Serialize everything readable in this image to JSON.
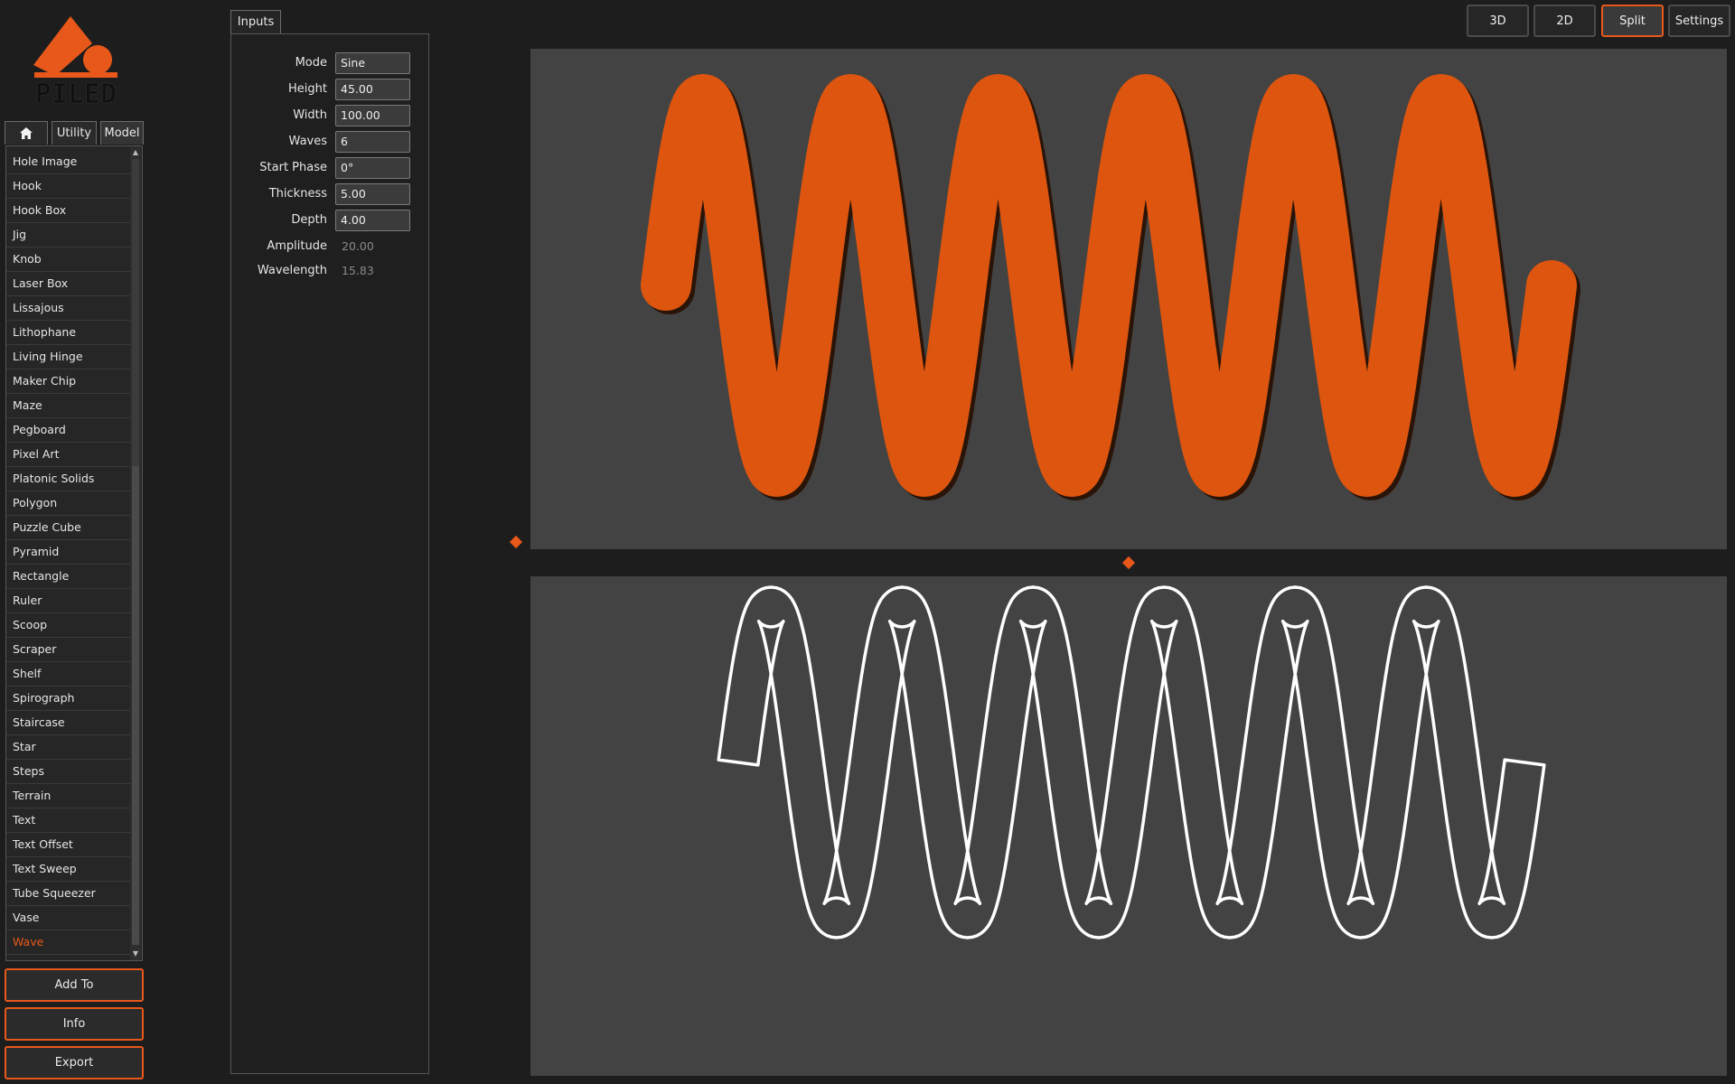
{
  "app": {
    "logo_text": "PILED",
    "accent": "#e8581a"
  },
  "sidebar": {
    "tabs": [
      {
        "icon": "home-icon"
      },
      {
        "label": "Utility"
      },
      {
        "label": "Model"
      }
    ],
    "items": [
      "Hole Image",
      "Hook",
      "Hook Box",
      "Jig",
      "Knob",
      "Laser Box",
      "Lissajous",
      "Lithophane",
      "Living Hinge",
      "Maker Chip",
      "Maze",
      "Pegboard",
      "Pixel Art",
      "Platonic Solids",
      "Polygon",
      "Puzzle Cube",
      "Pyramid",
      "Rectangle",
      "Ruler",
      "Scoop",
      "Scraper",
      "Shelf",
      "Spirograph",
      "Staircase",
      "Star",
      "Steps",
      "Terrain",
      "Text",
      "Text Offset",
      "Text Sweep",
      "Tube Squeezer",
      "Vase",
      "Wave"
    ],
    "active_item": "Wave",
    "actions": {
      "add_to": "Add To",
      "info": "Info",
      "export": "Export"
    }
  },
  "inputs": {
    "tab_label": "Inputs",
    "fields": [
      {
        "label": "Mode",
        "value": "Sine"
      },
      {
        "label": "Height",
        "value": "45.00"
      },
      {
        "label": "Width",
        "value": "100.00"
      },
      {
        "label": "Waves",
        "value": "6"
      },
      {
        "label": "Start Phase",
        "value": "0°"
      },
      {
        "label": "Thickness",
        "value": "5.00"
      },
      {
        "label": "Depth",
        "value": "4.00"
      }
    ],
    "readonly": [
      {
        "label": "Amplitude",
        "value": "20.00"
      },
      {
        "label": "Wavelength",
        "value": "15.83"
      }
    ]
  },
  "view_buttons": {
    "b3d": "3D",
    "b2d": "2D",
    "split": "Split",
    "settings": "Settings",
    "active": "Split"
  },
  "colors": {
    "model_fill": "#dd550f",
    "outline": "#ffffff",
    "viewport_bg": "#434343"
  }
}
